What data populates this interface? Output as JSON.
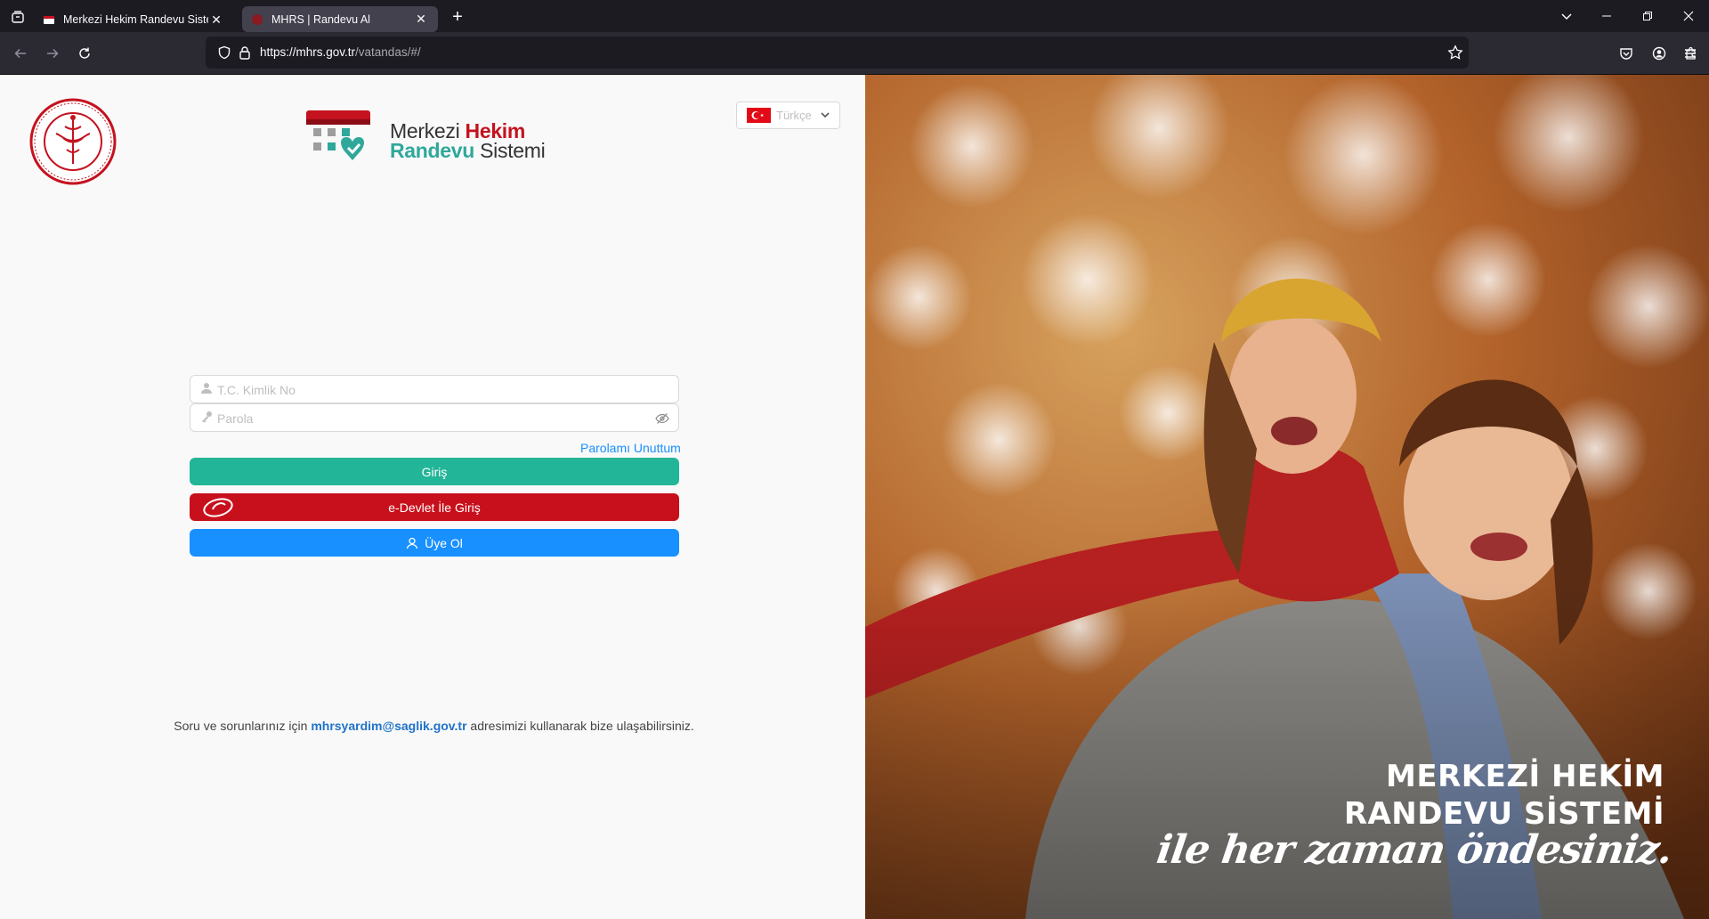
{
  "browser": {
    "tabs": [
      {
        "title": "Merkezi Hekim Randevu Sistemi",
        "active": false
      },
      {
        "title": "MHRS | Randevu Al",
        "active": true
      }
    ],
    "url_host": "https://mhrs.gov.tr",
    "url_path": "/vatandas/#/"
  },
  "header": {
    "logo_line1_a": "Merkezi ",
    "logo_line1_b": "Hekim",
    "logo_line2_a": "Randevu",
    "logo_line2_b": " Sistemi",
    "language": "Türkçe"
  },
  "login": {
    "tc_placeholder": "T.C. Kimlik No",
    "password_placeholder": "Parola",
    "forgot_label": "Parolamı Unuttum",
    "login_label": "Giriş",
    "edevlet_label": "e-Devlet İle Giriş",
    "register_label": "Üye Ol"
  },
  "footer": {
    "contact_prefix": "Soru ve sorunlarınız için ",
    "contact_email": "mhrsyardim@saglik.gov.tr",
    "contact_suffix": " adresimizi kullanarak bize ulaşabilirsiniz."
  },
  "hero": {
    "slogan_line1": "MERKEZİ HEKİM",
    "slogan_line2": "RANDEVU SİSTEMİ",
    "slogan_script": "ile her zaman öndesiniz."
  },
  "colors": {
    "brand_red": "#c5121f",
    "brand_teal": "#2fa89b",
    "login_green": "#23b597",
    "edevlet_red": "#c8101c",
    "register_blue": "#1890ff"
  }
}
